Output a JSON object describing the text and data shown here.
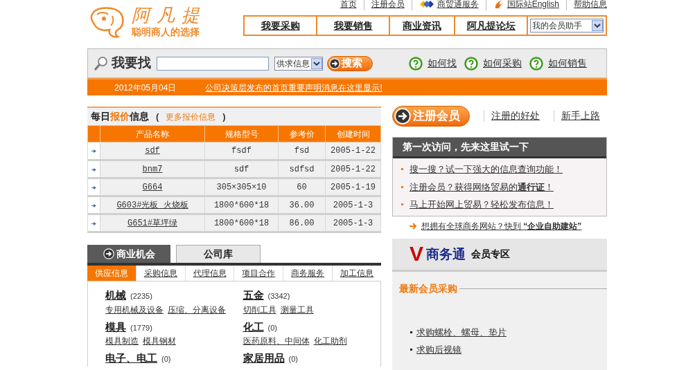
{
  "header": {
    "logo_name": "阿凡提",
    "slogan": "聪明商人的选择",
    "top_links": [
      {
        "label": "首页",
        "kind": "plain"
      },
      {
        "label": "注册会员",
        "kind": "plain"
      },
      {
        "label": "商贸通服务",
        "kind": "diamond"
      },
      {
        "label": "国际站English",
        "kind": "flame"
      },
      {
        "label": "帮助信息",
        "kind": "plain"
      }
    ],
    "nav": [
      "我要采购",
      "我要销售",
      "商业资讯",
      "阿凡提论坛"
    ],
    "member_select": "我的会员助手"
  },
  "search": {
    "title": "我要找",
    "category": "供求信息",
    "button": "搜索",
    "help_links": [
      "如何找",
      "如何采购",
      "如何销售"
    ]
  },
  "notice": {
    "date": "2012年05月04日",
    "message": "公司决策层发布的首页重要声明消息在这里显示!"
  },
  "prices": {
    "title_start": "每日",
    "title_highlight": "报价",
    "title_end": "信息",
    "paren_open": "(",
    "more": "更多报价信息",
    "paren_close": ")",
    "columns": [
      "产品名称",
      "规格型号",
      "参考价",
      "创建时间"
    ],
    "rows": [
      [
        "sdf",
        "fsdf",
        "fsd",
        "2005-1-22"
      ],
      [
        "bnm7",
        "sdf",
        "sdfsd",
        "2005-1-22"
      ],
      [
        "G664",
        "305×305×10",
        "60",
        "2005-1-19"
      ],
      [
        "G603#光板 火烧板",
        "1800*600*18",
        "36.00",
        "2005-1-3"
      ],
      [
        "G651#草坪绿",
        "1800*600*18",
        "86.00",
        "2005-1-3"
      ]
    ]
  },
  "register": {
    "button": "注册会员",
    "links": [
      "注册的好处",
      "新手上路"
    ]
  },
  "first_visit": {
    "title": "第一次访问，先来这里试一下",
    "items": [
      "搜一搜？试一下强大的信息查询功能！",
      "注册会员？获得网络贸易的**通行证**！",
      "马上开始网上贸易？轻松发布信息！"
    ],
    "promo": "想拥有全球商务网站？快到 **“企业自助建站”**"
  },
  "opportunities": {
    "tabs": [
      {
        "label": "商业机会",
        "selected": true
      },
      {
        "label": "公司库",
        "selected": false
      }
    ],
    "subtabs": [
      {
        "label": "供应信息",
        "selected": true
      },
      {
        "label": "采购信息",
        "selected": false
      },
      {
        "label": "代理信息",
        "selected": false
      },
      {
        "label": "项目合作",
        "selected": false
      },
      {
        "label": "商务服务",
        "selected": false
      },
      {
        "label": "加工信息",
        "selected": false
      }
    ],
    "categories": [
      {
        "name": "机械",
        "count": "(2235)",
        "links": [
          "专用机械及设备",
          "压缩、分离设备"
        ]
      },
      {
        "name": "五金",
        "count": "(3342)",
        "links": [
          "切削工具",
          "测量工具"
        ]
      },
      {
        "name": "模具",
        "count": "(1779)",
        "links": [
          "模具制造",
          "模具钢材"
        ]
      },
      {
        "name": "化工",
        "count": "(0)",
        "links": [
          "医药原料、中间体",
          "化工助剂"
        ]
      },
      {
        "name": "电子、电工",
        "count": "(0)"
      },
      {
        "name": "家居用品",
        "count": "(0)"
      }
    ]
  },
  "vip": {
    "mark": "V",
    "brand": "商务通",
    "title": "会员专区",
    "section": "最新会员采购",
    "items": [
      "求购螺栓、螺母、垫片",
      "求购后视镜"
    ]
  }
}
